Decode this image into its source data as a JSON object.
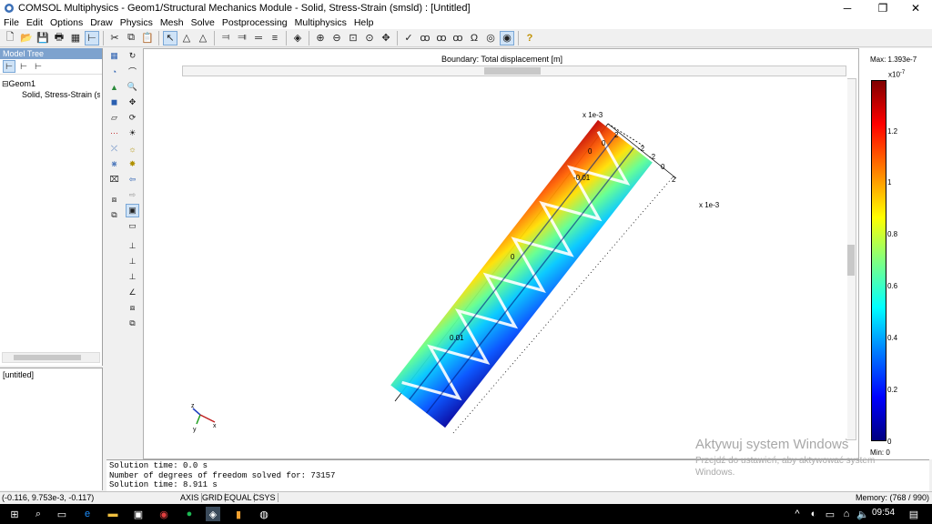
{
  "window": {
    "title": "COMSOL Multiphysics - Geom1/Structural Mechanics Module - Solid, Stress-Strain (smsld) : [Untitled]",
    "minimize": "─",
    "maximize": "❐",
    "close": "✕"
  },
  "menu": [
    "File",
    "Edit",
    "Options",
    "Draw",
    "Physics",
    "Mesh",
    "Solve",
    "Postprocessing",
    "Multiphysics",
    "Help"
  ],
  "model_tree": {
    "header": "Model Tree",
    "items": [
      "Geom1",
      "Solid, Stress-Strain (sm"
    ],
    "expander": "⊟"
  },
  "properties_panel": {
    "text": "[untitled]"
  },
  "plot": {
    "title": "Boundary: Total displacement [m]",
    "scale_label_top": "x 1e-3",
    "scale_label_right": "x 1e-3",
    "axis_labels": [
      "2",
      "0",
      "-2",
      "0",
      "-0.01",
      "2",
      "0",
      "-2",
      "0",
      "0.01"
    ],
    "triad": {
      "z": "z",
      "y": "y",
      "x": "x"
    }
  },
  "colorbar": {
    "max_label": "Max: 1.393e-7",
    "exponent": "x10",
    "exponent_power": "-7",
    "min_label": "Min: 0",
    "ticks": [
      "1.2",
      "1",
      "0.8",
      "0.6",
      "0.4",
      "0.2",
      "0"
    ]
  },
  "console": {
    "lines": [
      "Solution time: 0.0 s",
      "Number of degrees of freedom solved for: 73157",
      "Solution time: 8.911 s"
    ]
  },
  "statusbar": {
    "coords": "(-0.116, 9.753e-3, -0.117)",
    "buttons": [
      "AXIS",
      "GRID",
      "EQUAL",
      "CSYS"
    ],
    "memory": "Memory: (768 / 990)"
  },
  "watermark": {
    "title": "Aktywuj system Windows",
    "subtitle": "Przejdź do ustawień, aby aktywować system Windows."
  },
  "taskbar": {
    "time": "09:54"
  },
  "colors": {
    "accent": "#7da2ce",
    "console_bg": "#ffffff"
  }
}
